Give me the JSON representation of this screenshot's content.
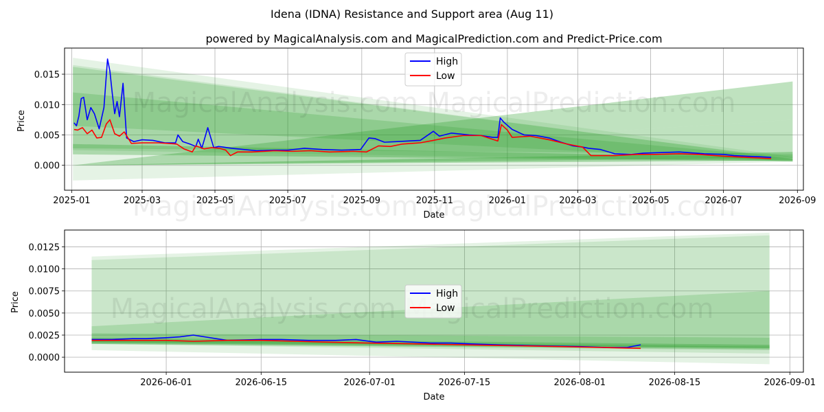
{
  "suptitle": "Idena (IDNA) Resistance and Support area (Aug 11)",
  "colors": {
    "high": "#0000ff",
    "low": "#ff0000",
    "band": "#2ca02c",
    "grid": "#b0b0b0"
  },
  "watermark": "MagicalAnalysis.com    MagicalPrediction.com",
  "chart_data": [
    {
      "type": "line",
      "title": "powered by MagicalAnalysis.com and MagicalPrediction.com and Predict-Price.com",
      "xlabel": "Date",
      "ylabel": "Price",
      "x_axis": "date",
      "xlim": [
        "2024-12-26",
        "2026-09-06"
      ],
      "ylim": [
        -0.0041,
        0.0193
      ],
      "xticks": [
        "2025-01",
        "2025-03",
        "2025-05",
        "2025-07",
        "2025-09",
        "2025-11",
        "2026-01",
        "2026-03",
        "2026-05",
        "2026-07",
        "2026-09"
      ],
      "yticks": [
        0.0,
        0.005,
        0.01,
        0.015
      ],
      "ytick_labels": [
        "0.000",
        "0.005",
        "0.010",
        "0.015"
      ],
      "grid": true,
      "legend": {
        "position": "top-center",
        "entries": [
          "High",
          "Low"
        ]
      },
      "bands": [
        {
          "x": [
            "2025-01-02",
            "2026-08-28"
          ],
          "lower": [
            -0.0025,
            0.0006
          ],
          "upper": [
            0.0177,
            0.0014
          ]
        },
        {
          "x": [
            "2025-01-02",
            "2026-08-28"
          ],
          "lower": [
            0.0025,
            0.0006
          ],
          "upper": [
            0.0165,
            0.001
          ]
        },
        {
          "x": [
            "2025-01-02",
            "2026-08-28"
          ],
          "lower": [
            0.0065,
            0.0006
          ],
          "upper": [
            0.0162,
            0.0011
          ]
        },
        {
          "x": [
            "2025-01-02",
            "2026-08-28"
          ],
          "lower": [
            0.0028,
            0.0018
          ],
          "upper": [
            0.012,
            0.0012
          ]
        },
        {
          "x": [
            "2025-01-02",
            "2026-08-28"
          ],
          "lower": [
            0.0018,
            0.0007
          ],
          "upper": [
            0.0035,
            0.0012
          ]
        },
        {
          "x": [
            "2025-01-02",
            "2026-08-28"
          ],
          "lower": [
            0.0,
            0.0075
          ],
          "upper": [
            0.0,
            0.0138
          ]
        },
        {
          "x": [
            "2025-01-02",
            "2026-08-28"
          ],
          "lower": [
            0.0,
            0.0012
          ],
          "upper": [
            0.0,
            0.0075
          ]
        },
        {
          "x": [
            "2025-01-02",
            "2026-08-28"
          ],
          "lower": [
            0.0,
            0.0008
          ],
          "upper": [
            0.0,
            0.0022
          ]
        }
      ],
      "series": [
        {
          "name": "High",
          "x": [
            "2025-01-03",
            "2025-01-05",
            "2025-01-07",
            "2025-01-09",
            "2025-01-11",
            "2025-01-14",
            "2025-01-17",
            "2025-01-20",
            "2025-01-24",
            "2025-01-28",
            "2025-01-31",
            "2025-02-02",
            "2025-02-04",
            "2025-02-06",
            "2025-02-08",
            "2025-02-10",
            "2025-02-13",
            "2025-02-16",
            "2025-02-22",
            "2025-03-01",
            "2025-03-10",
            "2025-03-20",
            "2025-03-29",
            "2025-03-31",
            "2025-04-04",
            "2025-04-10",
            "2025-04-15",
            "2025-04-17",
            "2025-04-20",
            "2025-04-25",
            "2025-04-30",
            "2025-05-04",
            "2025-05-08",
            "2025-05-15",
            "2025-05-25",
            "2025-06-05",
            "2025-06-20",
            "2025-07-01",
            "2025-07-15",
            "2025-07-30",
            "2025-08-15",
            "2025-08-31",
            "2025-09-07",
            "2025-09-12",
            "2025-09-20",
            "2025-10-01",
            "2025-10-10",
            "2025-10-20",
            "2025-10-31",
            "2025-11-05",
            "2025-11-15",
            "2025-11-30",
            "2025-12-10",
            "2025-12-20",
            "2025-12-24",
            "2025-12-26",
            "2025-12-29",
            "2026-01-05",
            "2026-01-15",
            "2026-01-25",
            "2026-02-05",
            "2026-02-15",
            "2026-02-25",
            "2026-03-05",
            "2026-03-10",
            "2026-03-20",
            "2026-04-01",
            "2026-04-15",
            "2026-04-25",
            "2026-05-10",
            "2026-05-25",
            "2026-06-01",
            "2026-06-15",
            "2026-07-01",
            "2026-07-10",
            "2026-07-20",
            "2026-08-01",
            "2026-08-10"
          ],
          "values": [
            0.007,
            0.0065,
            0.0081,
            0.011,
            0.0112,
            0.0075,
            0.0095,
            0.0085,
            0.006,
            0.0095,
            0.0175,
            0.0155,
            0.0118,
            0.0085,
            0.0105,
            0.008,
            0.0135,
            0.0045,
            0.0039,
            0.0042,
            0.0041,
            0.0037,
            0.0037,
            0.005,
            0.0039,
            0.0035,
            0.0031,
            0.0043,
            0.0028,
            0.0062,
            0.0029,
            0.0031,
            0.003,
            0.0028,
            0.0026,
            0.0024,
            0.0025,
            0.0025,
            0.0028,
            0.0026,
            0.0025,
            0.0026,
            0.0045,
            0.0044,
            0.0038,
            0.0039,
            0.004,
            0.0041,
            0.0056,
            0.0048,
            0.0053,
            0.005,
            0.0049,
            0.0046,
            0.0046,
            0.0078,
            0.0071,
            0.0059,
            0.005,
            0.0049,
            0.0045,
            0.0038,
            0.0032,
            0.003,
            0.0028,
            0.0026,
            0.0019,
            0.0018,
            0.002,
            0.0021,
            0.0022,
            0.0021,
            0.0019,
            0.0018,
            0.0016,
            0.0015,
            0.0014,
            0.0013
          ]
        },
        {
          "name": "Low",
          "x": [
            "2025-01-03",
            "2025-01-06",
            "2025-01-10",
            "2025-01-14",
            "2025-01-18",
            "2025-01-22",
            "2025-01-26",
            "2025-01-30",
            "2025-02-02",
            "2025-02-06",
            "2025-02-10",
            "2025-02-14",
            "2025-02-20",
            "2025-03-01",
            "2025-03-15",
            "2025-03-30",
            "2025-04-05",
            "2025-04-12",
            "2025-04-15",
            "2025-04-22",
            "2025-04-28",
            "2025-05-05",
            "2025-05-10",
            "2025-05-14",
            "2025-05-20",
            "2025-06-01",
            "2025-06-20",
            "2025-07-05",
            "2025-07-20",
            "2025-08-05",
            "2025-08-25",
            "2025-09-05",
            "2025-09-15",
            "2025-09-25",
            "2025-10-05",
            "2025-10-20",
            "2025-10-31",
            "2025-11-10",
            "2025-11-25",
            "2025-12-10",
            "2025-12-24",
            "2025-12-27",
            "2026-01-01",
            "2026-01-05",
            "2026-01-20",
            "2026-02-05",
            "2026-02-20",
            "2026-03-05",
            "2026-03-12",
            "2026-04-01",
            "2026-04-20",
            "2026-05-05",
            "2026-05-25",
            "2026-06-10",
            "2026-07-01",
            "2026-07-20",
            "2026-08-10"
          ],
          "values": [
            0.0059,
            0.0058,
            0.0062,
            0.0052,
            0.0058,
            0.0045,
            0.0046,
            0.0068,
            0.0075,
            0.0052,
            0.0048,
            0.0055,
            0.0036,
            0.0037,
            0.0037,
            0.0035,
            0.0027,
            0.0022,
            0.0032,
            0.0027,
            0.0029,
            0.0028,
            0.0025,
            0.0016,
            0.0022,
            0.0022,
            0.0024,
            0.0023,
            0.0024,
            0.0022,
            0.0023,
            0.0022,
            0.0032,
            0.0031,
            0.0035,
            0.0037,
            0.0041,
            0.0045,
            0.0049,
            0.0049,
            0.004,
            0.0067,
            0.0058,
            0.0046,
            0.0048,
            0.0042,
            0.0035,
            0.003,
            0.0016,
            0.0016,
            0.0018,
            0.0018,
            0.0019,
            0.0018,
            0.0015,
            0.0013,
            0.0011
          ]
        }
      ]
    },
    {
      "type": "line",
      "title": "",
      "xlabel": "Date",
      "ylabel": "Price",
      "x_axis": "date",
      "xlim": [
        "2026-05-17",
        "2026-09-03"
      ],
      "ylim": [
        -0.0017,
        0.0144
      ],
      "xticks": [
        "2026-06-01",
        "2026-06-15",
        "2026-07-01",
        "2026-07-15",
        "2026-08-01",
        "2026-08-15",
        "2026-09-01"
      ],
      "yticks": [
        0.0,
        0.0025,
        0.005,
        0.0075,
        0.01,
        0.0125
      ],
      "ytick_labels": [
        "0.0000",
        "0.0025",
        "0.0050",
        "0.0075",
        "0.0100",
        "0.0125"
      ],
      "grid": true,
      "legend": {
        "position": "center",
        "entries": [
          "High",
          "Low"
        ]
      },
      "bands": [
        {
          "x": [
            "2026-05-21",
            "2026-08-29"
          ],
          "lower": [
            0.0008,
            -0.0008
          ],
          "upper": [
            0.0114,
            0.0141
          ]
        },
        {
          "x": [
            "2026-05-21",
            "2026-08-29"
          ],
          "lower": [
            0.0015,
            0.0004
          ],
          "upper": [
            0.011,
            0.0138
          ]
        },
        {
          "x": [
            "2026-05-21",
            "2026-08-29"
          ],
          "lower": [
            0.0015,
            0.0008
          ],
          "upper": [
            0.0035,
            0.0075
          ]
        },
        {
          "x": [
            "2026-05-21",
            "2026-08-29"
          ],
          "lower": [
            0.0015,
            0.0009
          ],
          "upper": [
            0.0027,
            0.0022
          ]
        },
        {
          "x": [
            "2026-05-21",
            "2026-08-29"
          ],
          "lower": [
            0.0016,
            0.001
          ],
          "upper": [
            0.0022,
            0.0014
          ]
        },
        {
          "x": [
            "2026-05-21",
            "2026-08-29"
          ],
          "lower": [
            0.0017,
            0.0011
          ],
          "upper": [
            0.002,
            0.0012
          ]
        }
      ],
      "series": [
        {
          "name": "High",
          "x": [
            "2026-05-21",
            "2026-05-24",
            "2026-05-27",
            "2026-05-29",
            "2026-06-01",
            "2026-06-03",
            "2026-06-05",
            "2026-06-10",
            "2026-06-15",
            "2026-06-18",
            "2026-06-22",
            "2026-06-26",
            "2026-06-29",
            "2026-07-02",
            "2026-07-05",
            "2026-07-10",
            "2026-07-13",
            "2026-07-16",
            "2026-07-20",
            "2026-07-25",
            "2026-08-01",
            "2026-08-05",
            "2026-08-08",
            "2026-08-10"
          ],
          "values": [
            0.002,
            0.002,
            0.0021,
            0.0021,
            0.0022,
            0.0023,
            0.0025,
            0.0019,
            0.002,
            0.002,
            0.0019,
            0.0019,
            0.002,
            0.0017,
            0.0018,
            0.0016,
            0.0016,
            0.0015,
            0.0014,
            0.0013,
            0.0012,
            0.0011,
            0.0011,
            0.0014
          ]
        },
        {
          "name": "Low",
          "x": [
            "2026-05-21",
            "2026-05-26",
            "2026-06-01",
            "2026-06-05",
            "2026-06-10",
            "2026-06-15",
            "2026-06-20",
            "2026-06-25",
            "2026-07-01",
            "2026-07-08",
            "2026-07-15",
            "2026-07-22",
            "2026-07-29",
            "2026-08-04",
            "2026-08-10"
          ],
          "values": [
            0.0019,
            0.0019,
            0.0019,
            0.0018,
            0.0019,
            0.0019,
            0.0018,
            0.0017,
            0.0016,
            0.0015,
            0.0014,
            0.0013,
            0.0012,
            0.0011,
            0.001
          ]
        }
      ]
    }
  ]
}
